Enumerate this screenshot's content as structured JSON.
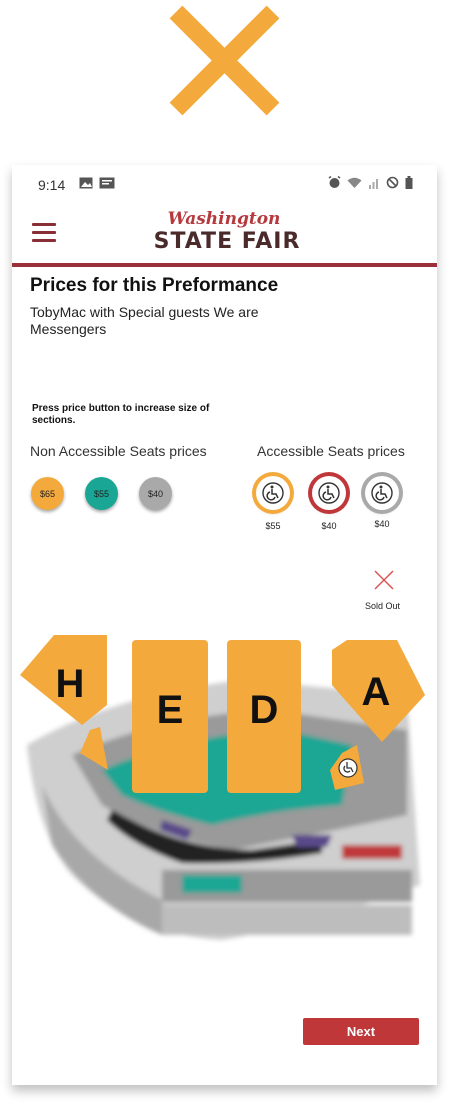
{
  "status_bar": {
    "time": "9:14"
  },
  "header": {
    "logo_script": "Washington",
    "logo_main": "STATE FAIR"
  },
  "page": {
    "title": "Prices for this Preformance",
    "subtitle": "TobyMac with Special guests We are Messengers",
    "instruction": "Press price button to increase size of sections."
  },
  "prices": {
    "non_accessible_label": "Non Accessible Seats prices",
    "accessible_label": "Accessible Seats prices",
    "non_accessible": [
      {
        "label": "$65",
        "color": "#f4a93c"
      },
      {
        "label": "$55",
        "color": "#1aa694"
      },
      {
        "label": "$40",
        "color": "#a9a9a9"
      }
    ],
    "accessible": [
      {
        "label": "$55",
        "color": "#f4a93c"
      },
      {
        "label": "$40",
        "color": "#c0373a"
      },
      {
        "label": "$40",
        "color": "#a9a9a9"
      }
    ]
  },
  "legend": {
    "sold_out_label": "Sold Out",
    "sold_out_color": "#d9534f"
  },
  "map": {
    "sections": [
      {
        "label": "H"
      },
      {
        "label": "E"
      },
      {
        "label": "D"
      },
      {
        "label": "A"
      }
    ],
    "highlight_color": "#f4a93c"
  },
  "actions": {
    "next_label": "Next"
  }
}
